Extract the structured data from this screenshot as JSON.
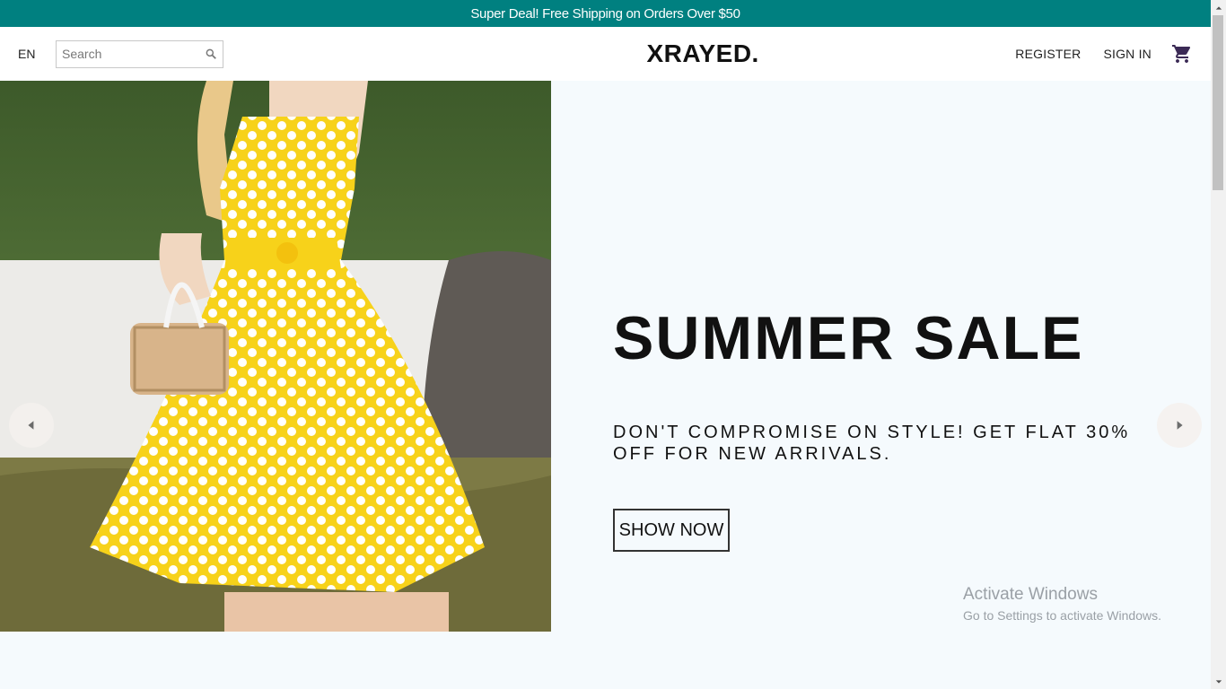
{
  "announcement": {
    "text": "Super Deal! Free Shipping on Orders Over $50"
  },
  "nav": {
    "language": "EN",
    "search_placeholder": "Search",
    "logo": "XRAYED.",
    "register": "REGISTER",
    "sign_in": "SIGN IN",
    "cart_icon": "cart-icon"
  },
  "hero": {
    "title": "SUMMER SALE",
    "description": "DON'T COMPROMISE ON STYLE! GET FLAT 30% OFF FOR NEW ARRIVALS.",
    "button": "SHOW NOW",
    "image": "woman-yellow-polka-dot-dress",
    "prev_icon": "arrow-left-icon",
    "next_icon": "arrow-right-icon"
  },
  "watermark": {
    "title": "Activate Windows",
    "subtitle": "Go to Settings to activate Windows."
  },
  "colors": {
    "announcement_bg": "#008080",
    "hero_bg": "#f5fafd",
    "dress_yellow": "#f7d21a"
  }
}
